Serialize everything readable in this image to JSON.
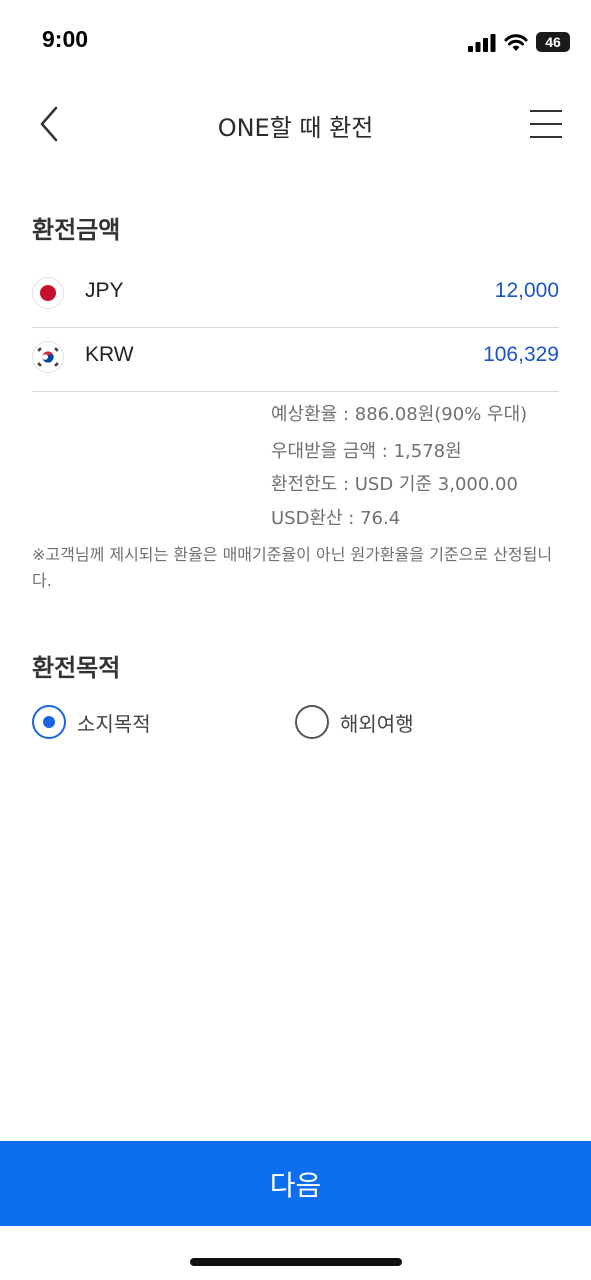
{
  "status_bar": {
    "time": "9:00",
    "battery": "46"
  },
  "header": {
    "title": "ONE할 때 환전"
  },
  "exchange_amount": {
    "section_title": "환전금액",
    "rows": [
      {
        "code": "JPY",
        "amount": "12,000"
      },
      {
        "code": "KRW",
        "amount": "106,329"
      }
    ]
  },
  "info": {
    "expected_rate": "예상환율 : 886.08원(90% 우대)",
    "preferential_amount": "우대받을 금액 : 1,578원",
    "exchange_limit": "환전한도 : USD 기준 3,000.00",
    "usd_conversion": "USD환산 : 76.4",
    "notice": "※고객님께 제시되는 환율은 매매기준율이 아닌 원가환율을 기준으로 산정됩니다."
  },
  "purpose": {
    "section_title": "환전목적",
    "options": [
      {
        "label": "소지목적",
        "selected": true
      },
      {
        "label": "해외여행",
        "selected": false
      }
    ]
  },
  "footer": {
    "next_label": "다음"
  },
  "colors": {
    "accent": "#0d6ef0",
    "amount_text": "#1b55c2",
    "radio_selected": "#1a64e4"
  }
}
